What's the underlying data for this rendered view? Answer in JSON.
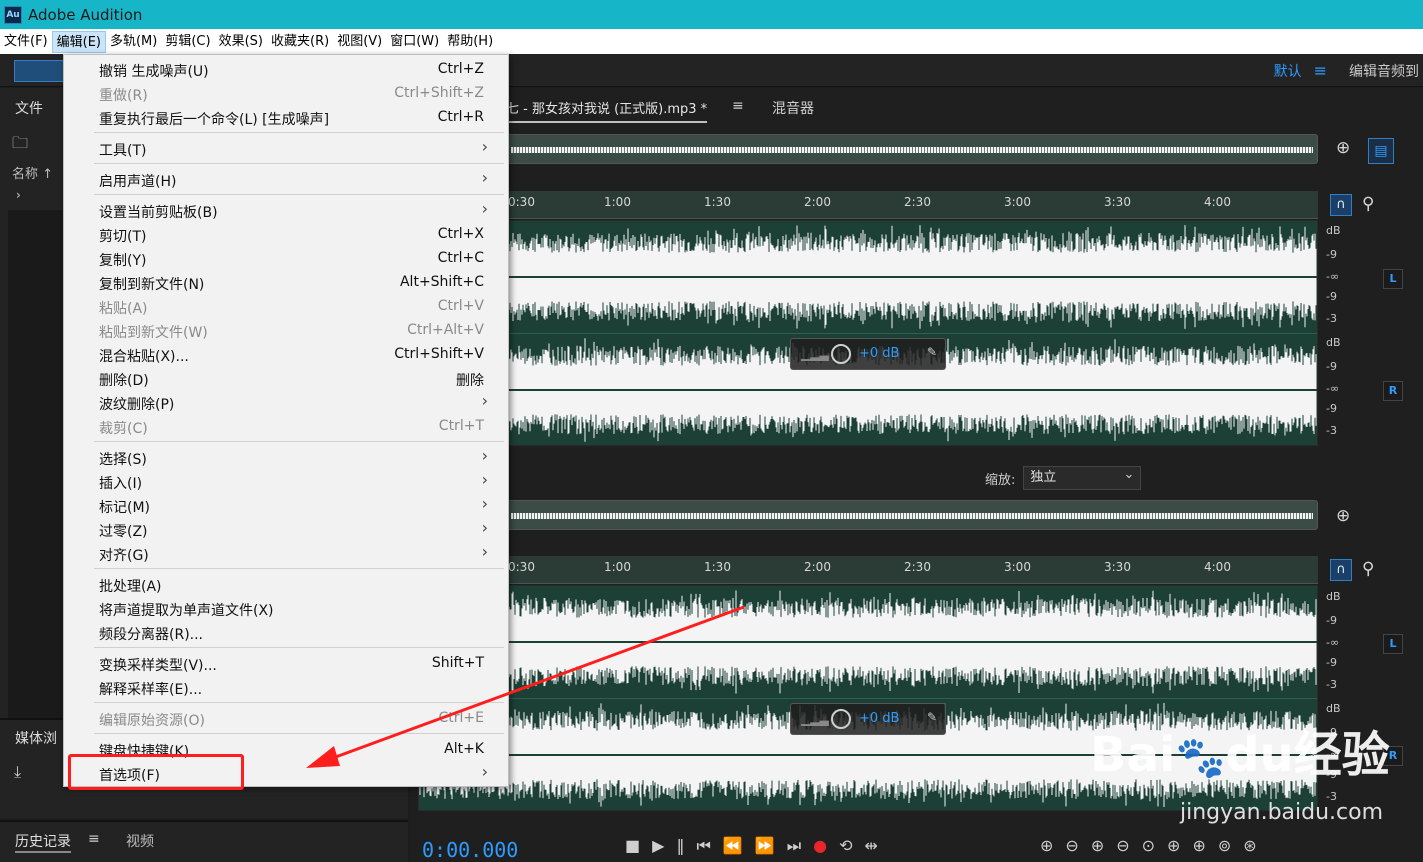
{
  "window": {
    "title": "Adobe Audition",
    "logo_text": "Au"
  },
  "menubar": {
    "items": [
      "文件(F)",
      "编辑(E)",
      "多轨(M)",
      "剪辑(C)",
      "效果(S)",
      "收藏夹(R)",
      "视图(V)",
      "窗口(W)",
      "帮助(H)"
    ],
    "active_index": 1
  },
  "toolbar": {
    "workspace": "默认",
    "workspace_menu_icon": "hamburger-icon",
    "edit_tab": "编辑音频到"
  },
  "left_panel": {
    "files_tab": "文件",
    "name_column": "名称 ↑"
  },
  "media_panel": {
    "tab": "媒体浏"
  },
  "history_panel": {
    "tab1": "历史记录",
    "tab2": "视频"
  },
  "editor": {
    "tab_file": "七 - 那女孩对我说 (正式版).mp3 *",
    "tab_mixer": "混音器",
    "ruler_ticks": [
      "0:30",
      "1:00",
      "1:30",
      "2:00",
      "2:30",
      "3:00",
      "3:30",
      "4:00"
    ],
    "db_scale": [
      "dB",
      "-9",
      "-∞",
      "-9",
      "-3"
    ],
    "channel_left": "L",
    "channel_right": "R",
    "hud_gain": "+0 dB",
    "zoom_label": "缩放:",
    "zoom_value": "独立"
  },
  "transport": {
    "time": "0:00.000"
  },
  "edit_menu": {
    "items": [
      {
        "label": "撤销 生成噪声(U)",
        "shortcut": "Ctrl+Z"
      },
      {
        "label": "重做(R)",
        "shortcut": "Ctrl+Shift+Z",
        "disabled": true
      },
      {
        "label": "重复执行最后一个命令(L) [生成噪声]",
        "shortcut": "Ctrl+R"
      },
      {
        "label": "工具(T)",
        "submenu": true
      },
      {
        "label": "启用声道(H)",
        "submenu": true
      },
      {
        "label": "设置当前剪贴板(B)",
        "submenu": true
      },
      {
        "label": "剪切(T)",
        "shortcut": "Ctrl+X"
      },
      {
        "label": "复制(Y)",
        "shortcut": "Ctrl+C"
      },
      {
        "label": "复制到新文件(N)",
        "shortcut": "Alt+Shift+C"
      },
      {
        "label": "粘贴(A)",
        "shortcut": "Ctrl+V",
        "disabled": true
      },
      {
        "label": "粘贴到新文件(W)",
        "shortcut": "Ctrl+Alt+V",
        "disabled": true
      },
      {
        "label": "混合粘贴(X)...",
        "shortcut": "Ctrl+Shift+V"
      },
      {
        "label": "删除(D)",
        "shortcut": "删除"
      },
      {
        "label": "波纹删除(P)",
        "submenu": true
      },
      {
        "label": "裁剪(C)",
        "shortcut": "Ctrl+T",
        "disabled": true
      },
      {
        "label": "选择(S)",
        "submenu": true
      },
      {
        "label": "插入(I)",
        "submenu": true
      },
      {
        "label": "标记(M)",
        "submenu": true
      },
      {
        "label": "过零(Z)",
        "submenu": true
      },
      {
        "label": "对齐(G)",
        "submenu": true
      },
      {
        "label": "批处理(A)"
      },
      {
        "label": "将声道提取为单声道文件(X)"
      },
      {
        "label": "频段分离器(R)..."
      },
      {
        "label": "变换采样类型(V)...",
        "shortcut": "Shift+T"
      },
      {
        "label": "解释采样率(E)..."
      },
      {
        "label": "编辑原始资源(O)",
        "shortcut": "Ctrl+E",
        "disabled": true
      },
      {
        "label": "键盘快捷键(K)...",
        "shortcut": "Alt+K"
      },
      {
        "label": "首选项(F)",
        "submenu": true
      }
    ]
  },
  "watermark": {
    "brand": "Bai",
    "brand2": "du",
    "brand3": "经验",
    "url": "jingyan.baidu.com"
  }
}
